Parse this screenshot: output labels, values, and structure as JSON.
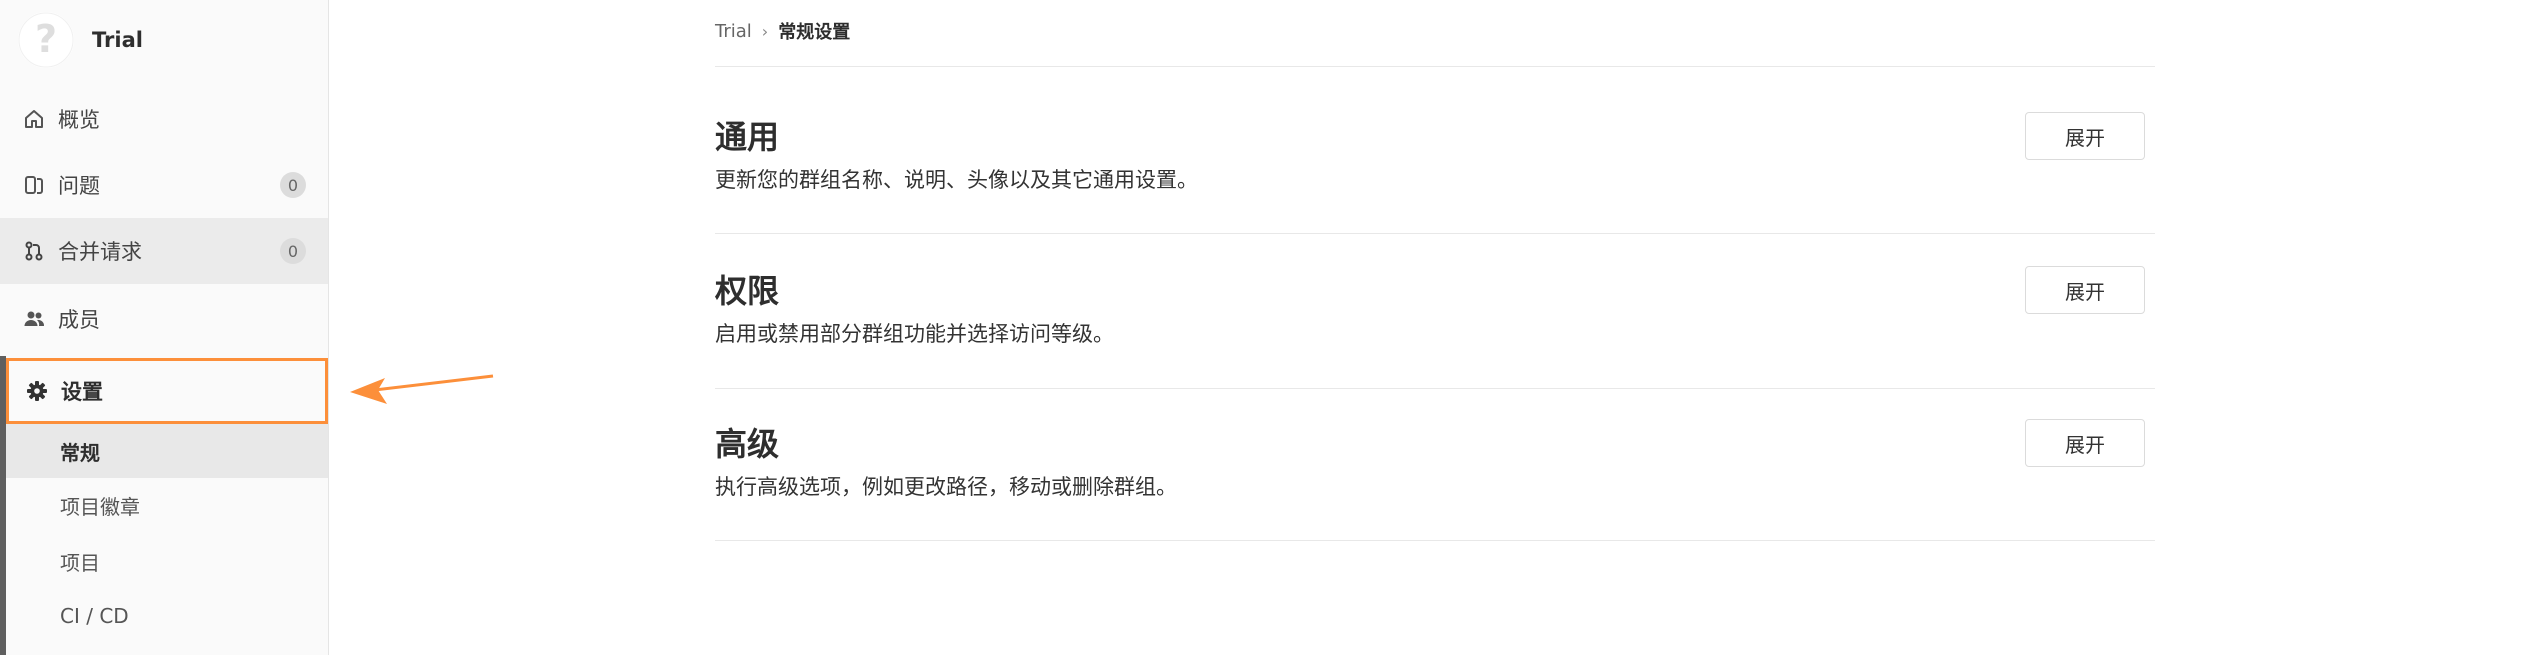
{
  "sidebar": {
    "brand": {
      "title": "Trial",
      "avatar_icon": "question-icon"
    },
    "items": [
      {
        "label": "概览",
        "icon": "home-icon"
      },
      {
        "label": "问题",
        "icon": "issues-icon",
        "count": "0"
      },
      {
        "label": "合并请求",
        "icon": "merge-request-icon",
        "count": "0"
      },
      {
        "label": "成员",
        "icon": "users-icon"
      }
    ],
    "settings": {
      "label": "设置",
      "icon": "gear-icon"
    },
    "sub_items": [
      {
        "label": "常规"
      },
      {
        "label": "项目徽章"
      },
      {
        "label": "项目"
      },
      {
        "label": "CI / CD"
      }
    ]
  },
  "breadcrumb": {
    "parent": "Trial",
    "current": "常规设置"
  },
  "sections": [
    {
      "title": "通用",
      "description": "更新您的群组名称、说明、头像以及其它通用设置。",
      "button": "展开"
    },
    {
      "title": "权限",
      "description": "启用或禁用部分群组功能并选择访问等级。",
      "button": "展开"
    },
    {
      "title": "高级",
      "description": "执行高级选项，例如更改路径，移动或删除群组。",
      "button": "展开"
    }
  ],
  "colors": {
    "highlight": "#fc8f3a",
    "sidebar_bg": "#fafafa",
    "active_bg": "#ebebeb"
  }
}
